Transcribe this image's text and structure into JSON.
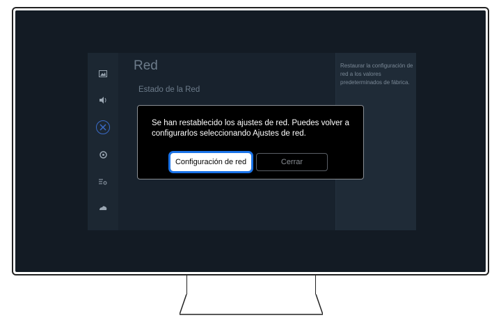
{
  "settings": {
    "title": "Red",
    "item": "Estado de la Red",
    "help": "Restaurar la configuración de red a los valores predeterminados de fábrica.",
    "rail_icons": [
      "picture-icon",
      "sound-icon",
      "network-icon",
      "support-icon",
      "general-icon",
      "care-icon"
    ]
  },
  "dialog": {
    "message": "Se han restablecido los ajustes de red. Puedes volver a configurarlos seleccionando Ajustes de red.",
    "primary_label": "Configuración de red",
    "secondary_label": "Cerrar"
  },
  "colors": {
    "screen": "#131b24",
    "focus_ring": "#1a73e8",
    "dialog_bg": "#000000"
  }
}
